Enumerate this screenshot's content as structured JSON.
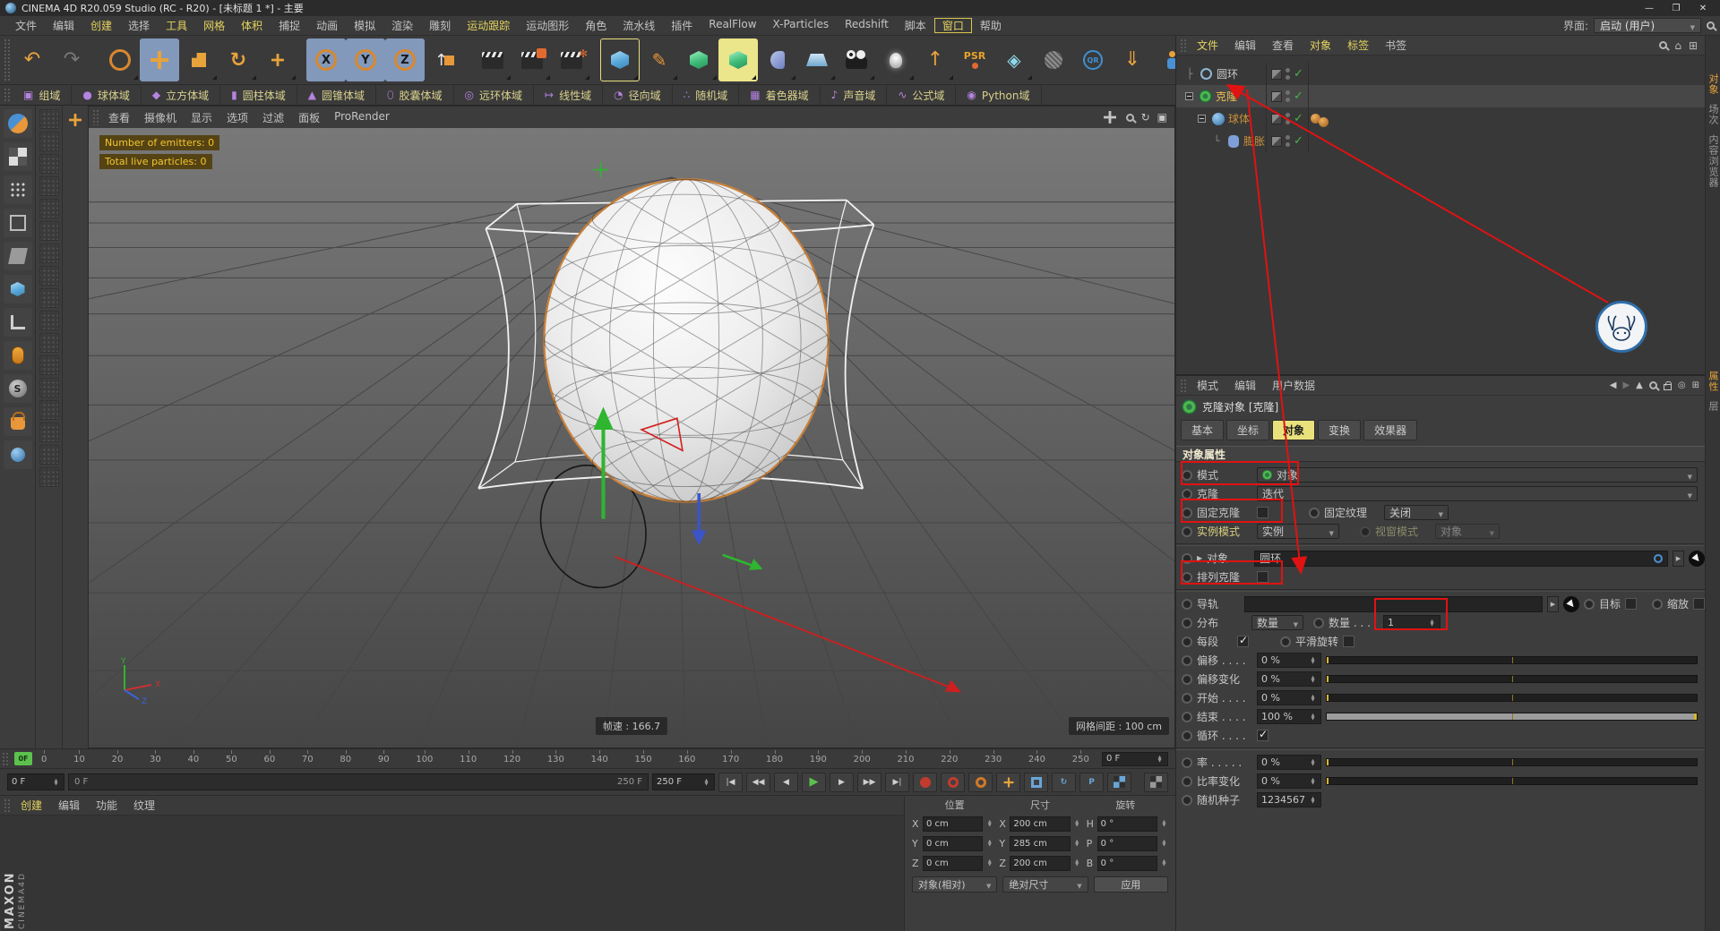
{
  "colors": {
    "annotation_red": "#e01212",
    "tab_active_yellow": "#e9e27c",
    "tool_active_blue": "#8399bb",
    "check_green": "#46b846",
    "field_purple": "#b583e0",
    "highlight_text": "#e5d35f"
  },
  "window": {
    "title": "CINEMA 4D R20.059 Studio (RC - R20) - [未标题 1 *] - 主要",
    "minimize": "—",
    "maximize": "❐",
    "close": "✕",
    "interface_label": "界面:",
    "interface_value": "启动 (用户)"
  },
  "menubar": {
    "items": [
      {
        "label": "文件",
        "cls": ""
      },
      {
        "label": "编辑",
        "cls": ""
      },
      {
        "label": "创建",
        "cls": "hl"
      },
      {
        "label": "选择",
        "cls": ""
      },
      {
        "label": "工具",
        "cls": "hl"
      },
      {
        "label": "网格",
        "cls": "hl"
      },
      {
        "label": "体积",
        "cls": "hl"
      },
      {
        "label": "捕捉",
        "cls": ""
      },
      {
        "label": "动画",
        "cls": ""
      },
      {
        "label": "模拟",
        "cls": ""
      },
      {
        "label": "渲染",
        "cls": ""
      },
      {
        "label": "雕刻",
        "cls": ""
      },
      {
        "label": "运动跟踪",
        "cls": "hl"
      },
      {
        "label": "运动图形",
        "cls": ""
      },
      {
        "label": "角色",
        "cls": ""
      },
      {
        "label": "流水线",
        "cls": ""
      },
      {
        "label": "插件",
        "cls": ""
      },
      {
        "label": "RealFlow",
        "cls": ""
      },
      {
        "label": "X-Particles",
        "cls": ""
      },
      {
        "label": "Redshift",
        "cls": ""
      },
      {
        "label": "脚本",
        "cls": ""
      },
      {
        "label": "窗口",
        "cls": "boxed"
      },
      {
        "label": "帮助",
        "cls": ""
      }
    ]
  },
  "toolbar": {
    "psr_label": "PSR",
    "qr_label": "QR",
    "field_glyph": "◈",
    "undo_glyph": "↶",
    "redo_glyph": "↷",
    "rotate_glyph": "↻",
    "x_label": "X",
    "y_label": "Y",
    "z_label": "Z",
    "up_glyph": "↑",
    "pen_glyph": "✎",
    "drop_glyph": "⇓"
  },
  "fields_toolbar": {
    "buttons": [
      {
        "label": "组域",
        "glyph": "▣"
      },
      {
        "label": "球体域",
        "glyph": "●"
      },
      {
        "label": "立方体域",
        "glyph": "◆"
      },
      {
        "label": "圆柱体域",
        "glyph": "▮"
      },
      {
        "label": "圆锥体域",
        "glyph": "▲"
      },
      {
        "label": "胶囊体域",
        "glyph": "⬯"
      },
      {
        "label": "远环体域",
        "glyph": "◎"
      },
      {
        "label": "线性域",
        "glyph": "↦"
      },
      {
        "label": "径向域",
        "glyph": "◔"
      },
      {
        "label": "随机域",
        "glyph": "∴"
      },
      {
        "label": "着色器域",
        "glyph": "▦"
      },
      {
        "label": "声音域",
        "glyph": "♪"
      },
      {
        "label": "公式域",
        "glyph": "∿"
      },
      {
        "label": "Python域",
        "glyph": "◉"
      }
    ]
  },
  "viewport": {
    "menus": [
      "查看",
      "摄像机",
      "显示",
      "选项",
      "过滤",
      "面板",
      "ProRender"
    ],
    "overlay_lines": [
      "Number of emitters: 0",
      "Total live particles: 0"
    ],
    "framerate": "帧速 : 166.7",
    "grid_spacing": "网格间距 : 100 cm",
    "axis": {
      "x": "X",
      "y": "Y",
      "z": "Z"
    }
  },
  "timeline": {
    "playhead": "0F",
    "ticks": [
      "0",
      "10",
      "20",
      "30",
      "40",
      "50",
      "60",
      "70",
      "80",
      "90",
      "100",
      "110",
      "120",
      "130",
      "140",
      "150",
      "160",
      "170",
      "180",
      "190",
      "200",
      "210",
      "220",
      "230",
      "240",
      "250"
    ],
    "end_value": "0 F"
  },
  "transport": {
    "current": "0 F",
    "range_start": "0 F",
    "range_end": "250 F",
    "end_spinner": "250 F"
  },
  "material_manager": {
    "menus": [
      {
        "label": "创建",
        "cls": "hl"
      },
      {
        "label": "编辑",
        "cls": ""
      },
      {
        "label": "功能",
        "cls": ""
      },
      {
        "label": "纹理",
        "cls": ""
      }
    ],
    "logo_main": "MAXON",
    "logo_sub": "CINEMA4D"
  },
  "coordinates": {
    "headers": [
      "位置",
      "尺寸",
      "旋转"
    ],
    "position": [
      {
        "l": "X",
        "v": "0 cm"
      },
      {
        "l": "Y",
        "v": "0 cm"
      },
      {
        "l": "Z",
        "v": "0 cm"
      }
    ],
    "size": [
      {
        "l": "X",
        "v": "200 cm"
      },
      {
        "l": "Y",
        "v": "285 cm"
      },
      {
        "l": "Z",
        "v": "200 cm"
      }
    ],
    "rotation": [
      {
        "l": "H",
        "v": "0 °"
      },
      {
        "l": "P",
        "v": "0 °"
      },
      {
        "l": "B",
        "v": "0 °"
      }
    ],
    "mode_dropdown": "对象(相对)",
    "size_dropdown": "绝对尺寸",
    "apply": "应用"
  },
  "object_manager": {
    "menus": [
      {
        "label": "文件",
        "cls": "hl"
      },
      {
        "label": "编辑",
        "cls": ""
      },
      {
        "label": "查看",
        "cls": ""
      },
      {
        "label": "对象",
        "cls": "hl"
      },
      {
        "label": "标签",
        "cls": "hl"
      },
      {
        "label": "书签",
        "cls": ""
      }
    ],
    "objects": [
      {
        "name": "圆环"
      },
      {
        "name": "克隆"
      },
      {
        "name": "球体"
      },
      {
        "name": "膨胀"
      }
    ]
  },
  "right_tabs": {
    "top": [
      {
        "label": "对象",
        "cls": "active"
      },
      {
        "label": "场次",
        "cls": ""
      },
      {
        "label": "内容浏览器",
        "cls": ""
      }
    ],
    "bottom": [
      {
        "label": "属性",
        "cls": "active"
      },
      {
        "label": "层",
        "cls": ""
      }
    ]
  },
  "attributes": {
    "menus": [
      "模式",
      "编辑",
      "用户数据"
    ],
    "title": "克隆对象 [克隆]",
    "tabs": [
      {
        "label": "基本",
        "cls": ""
      },
      {
        "label": "坐标",
        "cls": ""
      },
      {
        "label": "对象",
        "cls": "active"
      },
      {
        "label": "变换",
        "cls": ""
      },
      {
        "label": "效果器",
        "cls": ""
      }
    ],
    "section": "对象属性",
    "mode_label": "模式",
    "mode_value": "对象",
    "clone_label": "克隆",
    "clone_value": "迭代",
    "fixclone_label": "固定克隆",
    "fixtex_label": "固定纹理",
    "fixtex_value": "关闭",
    "instance_label": "实例模式",
    "instance_value": "实例",
    "viewmode_label": "视窗模式",
    "viewmode_value": "对象",
    "object_label": "对象 . .",
    "object_value": "圆环",
    "arrange_label": "排列克隆",
    "rail_label": "导轨",
    "target_label": "目标",
    "scalecb_label": "缩放",
    "dist_label": "分布",
    "dist_value": "数量",
    "count_label": "数量 . . .",
    "count_value": "1",
    "per_label": "每段",
    "smooth_label": "平滑旋转",
    "sliders1": [
      {
        "label": "偏移 . . . .",
        "value": "0 %",
        "cls": ""
      },
      {
        "label": "偏移变化",
        "value": "0 %",
        "cls": ""
      },
      {
        "label": "开始 . . . .",
        "value": "0 %",
        "cls": ""
      },
      {
        "label": "结束 . . . .",
        "value": "100 %",
        "cls": "full"
      }
    ],
    "loop_label": "循环 . . . .",
    "sliders2": [
      {
        "label": "率 . . . . .",
        "value": "0 %",
        "cls": ""
      },
      {
        "label": "比率变化",
        "value": "0 %",
        "cls": ""
      }
    ],
    "seed_label": "随机种子",
    "seed_value": "1234567"
  }
}
